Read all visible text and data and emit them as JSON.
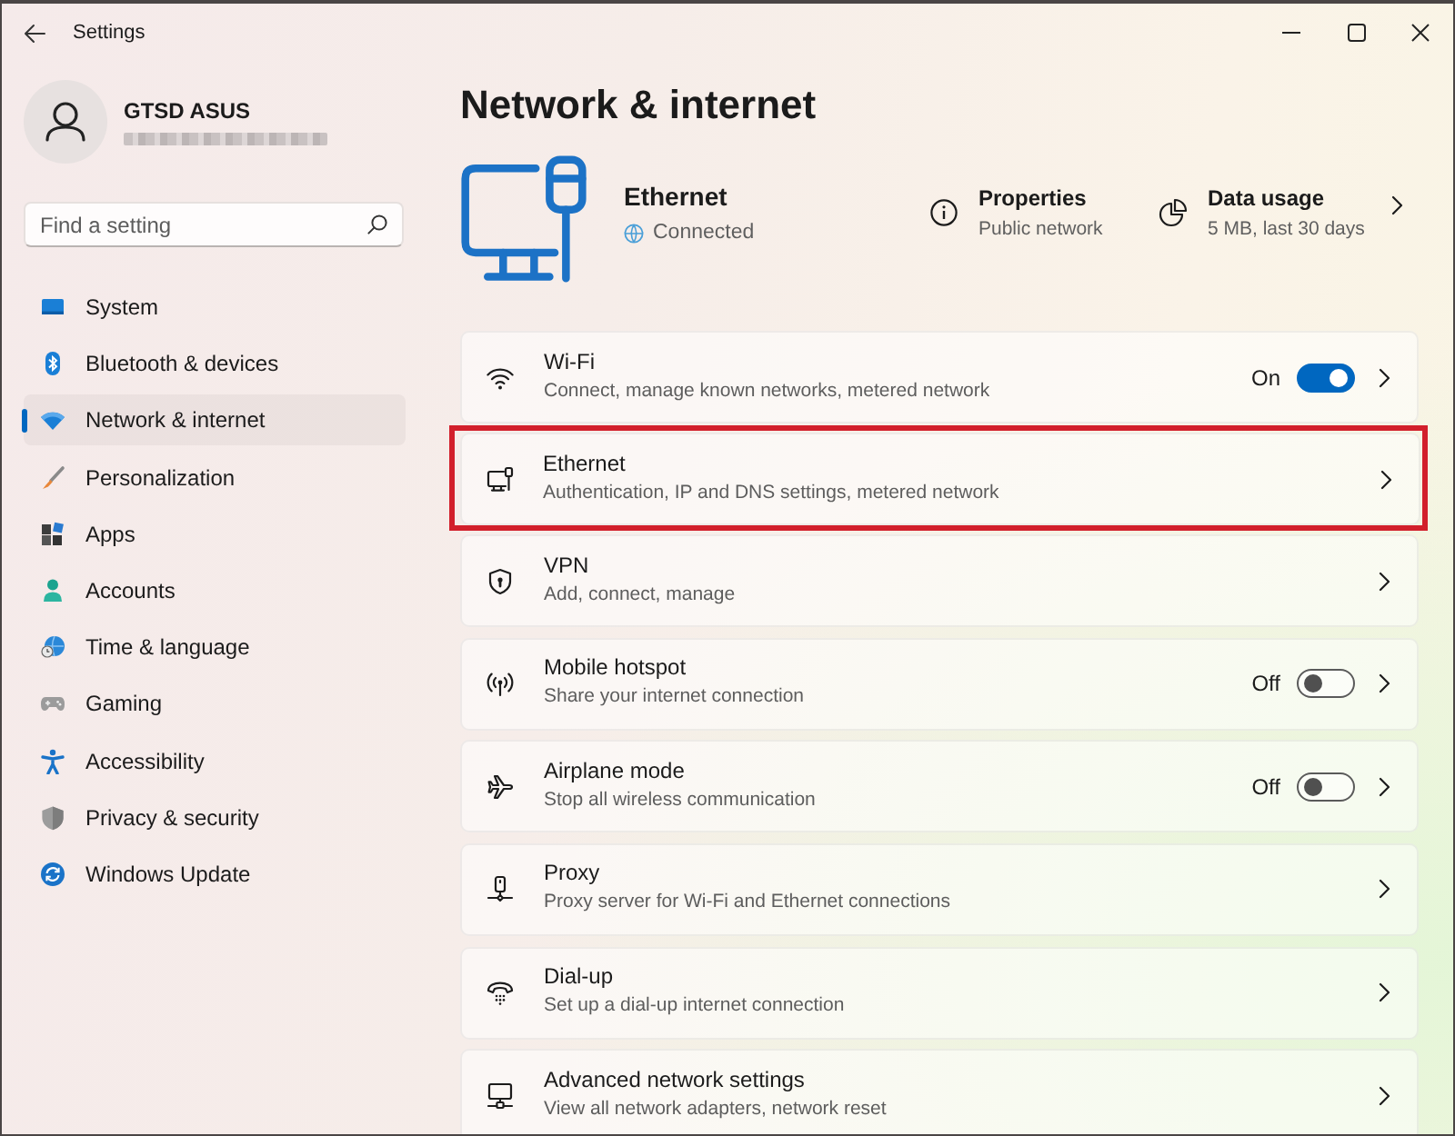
{
  "window": {
    "title": "Settings"
  },
  "profile": {
    "name": "GTSD ASUS"
  },
  "search": {
    "placeholder": "Find a setting"
  },
  "sidebar": {
    "items": [
      {
        "label": "System",
        "selected": false
      },
      {
        "label": "Bluetooth & devices",
        "selected": false
      },
      {
        "label": "Network & internet",
        "selected": true
      },
      {
        "label": "Personalization",
        "selected": false
      },
      {
        "label": "Apps",
        "selected": false
      },
      {
        "label": "Accounts",
        "selected": false
      },
      {
        "label": "Time & language",
        "selected": false
      },
      {
        "label": "Gaming",
        "selected": false
      },
      {
        "label": "Accessibility",
        "selected": false
      },
      {
        "label": "Privacy & security",
        "selected": false
      },
      {
        "label": "Windows Update",
        "selected": false
      }
    ]
  },
  "page": {
    "title": "Network & internet"
  },
  "connection": {
    "name": "Ethernet",
    "status": "Connected"
  },
  "connection_details": [
    {
      "label": "Properties",
      "value": "Public network"
    },
    {
      "label": "Data usage",
      "value": "5 MB, last 30 days"
    }
  ],
  "settings": [
    {
      "kind": "toggle",
      "title": "Wi-Fi",
      "description": "Connect, manage known networks, metered network",
      "state_label": "On",
      "on": true,
      "highlighted": false
    },
    {
      "kind": "link",
      "title": "Ethernet",
      "description": "Authentication, IP and DNS settings, metered network",
      "highlighted": true
    },
    {
      "kind": "link",
      "title": "VPN",
      "description": "Add, connect, manage",
      "highlighted": false
    },
    {
      "kind": "toggle",
      "title": "Mobile hotspot",
      "description": "Share your internet connection",
      "state_label": "Off",
      "on": false,
      "highlighted": false
    },
    {
      "kind": "toggle",
      "title": "Airplane mode",
      "description": "Stop all wireless communication",
      "state_label": "Off",
      "on": false,
      "highlighted": false
    },
    {
      "kind": "link",
      "title": "Proxy",
      "description": "Proxy server for Wi-Fi and Ethernet connections",
      "highlighted": false
    },
    {
      "kind": "link",
      "title": "Dial-up",
      "description": "Set up a dial-up internet connection",
      "highlighted": false
    },
    {
      "kind": "link",
      "title": "Advanced network settings",
      "description": "View all network adapters, network reset",
      "highlighted": false
    }
  ]
}
